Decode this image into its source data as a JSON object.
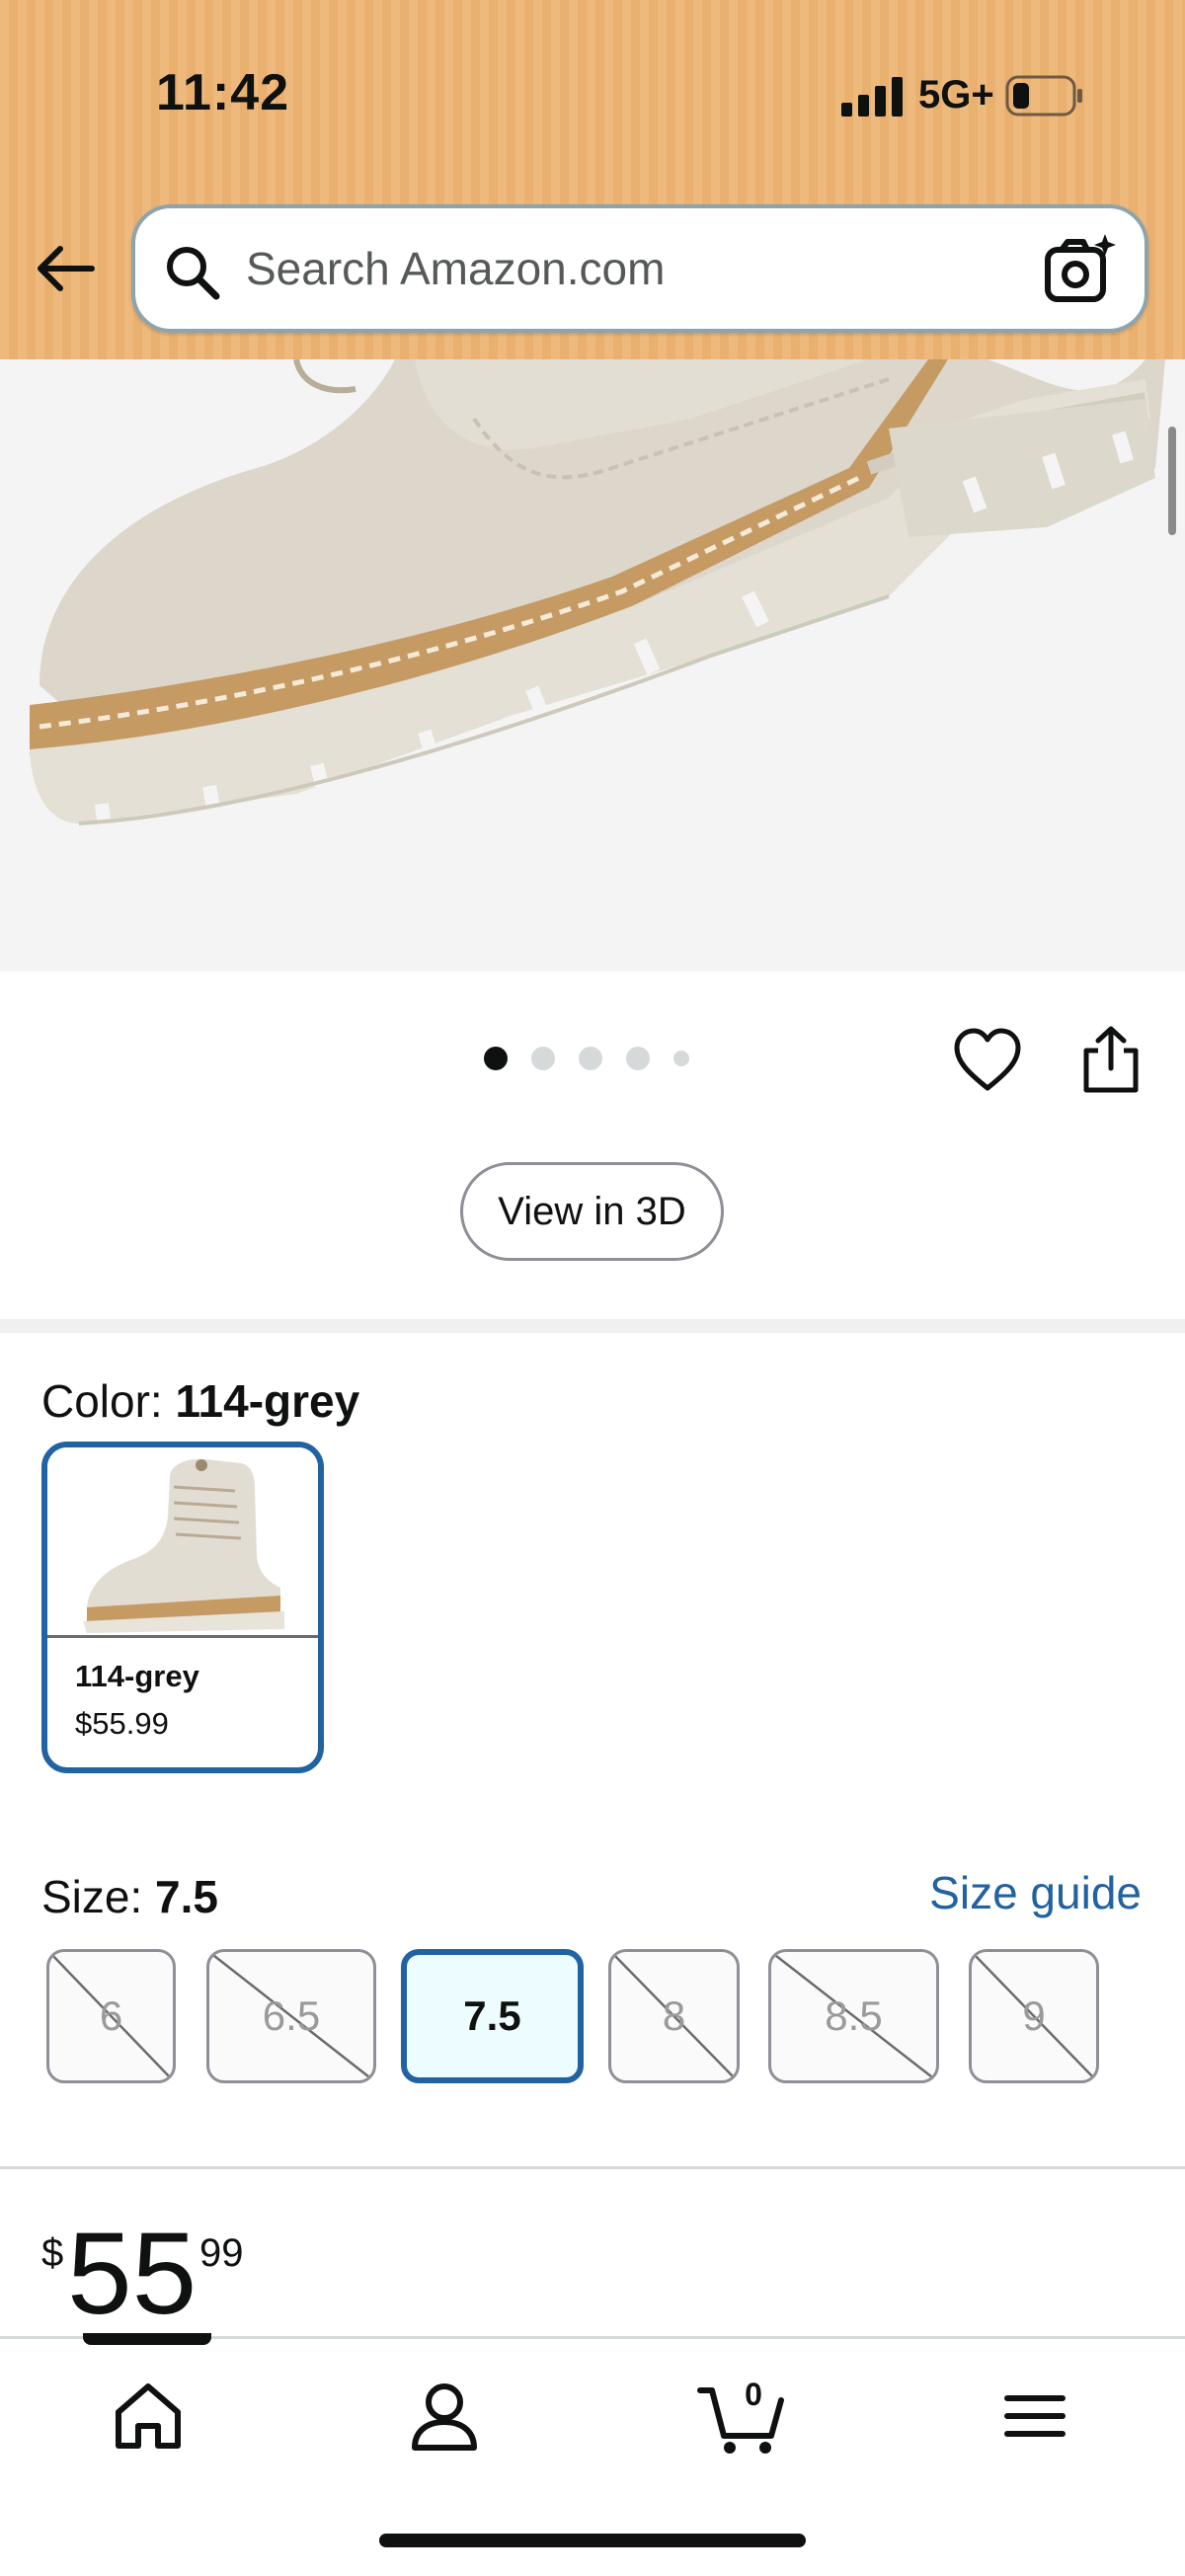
{
  "status_bar": {
    "time": "11:42",
    "network": "5G+",
    "icons": [
      "signal-icon",
      "battery-icon"
    ]
  },
  "header": {
    "back_icon": "arrow-left-icon",
    "search_placeholder": "Search Amazon.com",
    "search_value": "",
    "camera_icon": "camera-sparkle-icon",
    "background_color": "#eeb97c"
  },
  "gallery": {
    "image_count": 5,
    "active_index": 0,
    "actions": [
      "heart-icon",
      "share-icon"
    ],
    "view_3d_label": "View in 3D"
  },
  "color": {
    "label": "Color: ",
    "selected": "114-grey",
    "options": [
      {
        "name": "114-grey",
        "price": "$55.99"
      }
    ]
  },
  "size": {
    "label": "Size: ",
    "selected": "7.5",
    "guide_link": "Size guide",
    "options": [
      {
        "label": "6",
        "available": false
      },
      {
        "label": "6.5",
        "available": false
      },
      {
        "label": "7.5",
        "available": true,
        "selected": true
      },
      {
        "label": "8",
        "available": false
      },
      {
        "label": "8.5",
        "available": false
      },
      {
        "label": "9",
        "available": false
      }
    ]
  },
  "price": {
    "symbol": "$",
    "whole": "55",
    "fraction": "99"
  },
  "bottom_nav": {
    "items": [
      "home-icon",
      "account-icon",
      "cart-icon",
      "menu-icon"
    ],
    "active": "home-icon",
    "cart_count": "0"
  },
  "colors": {
    "accent": "#2162a1",
    "text": "#0f1111",
    "selected_bg": "#edfdff"
  }
}
